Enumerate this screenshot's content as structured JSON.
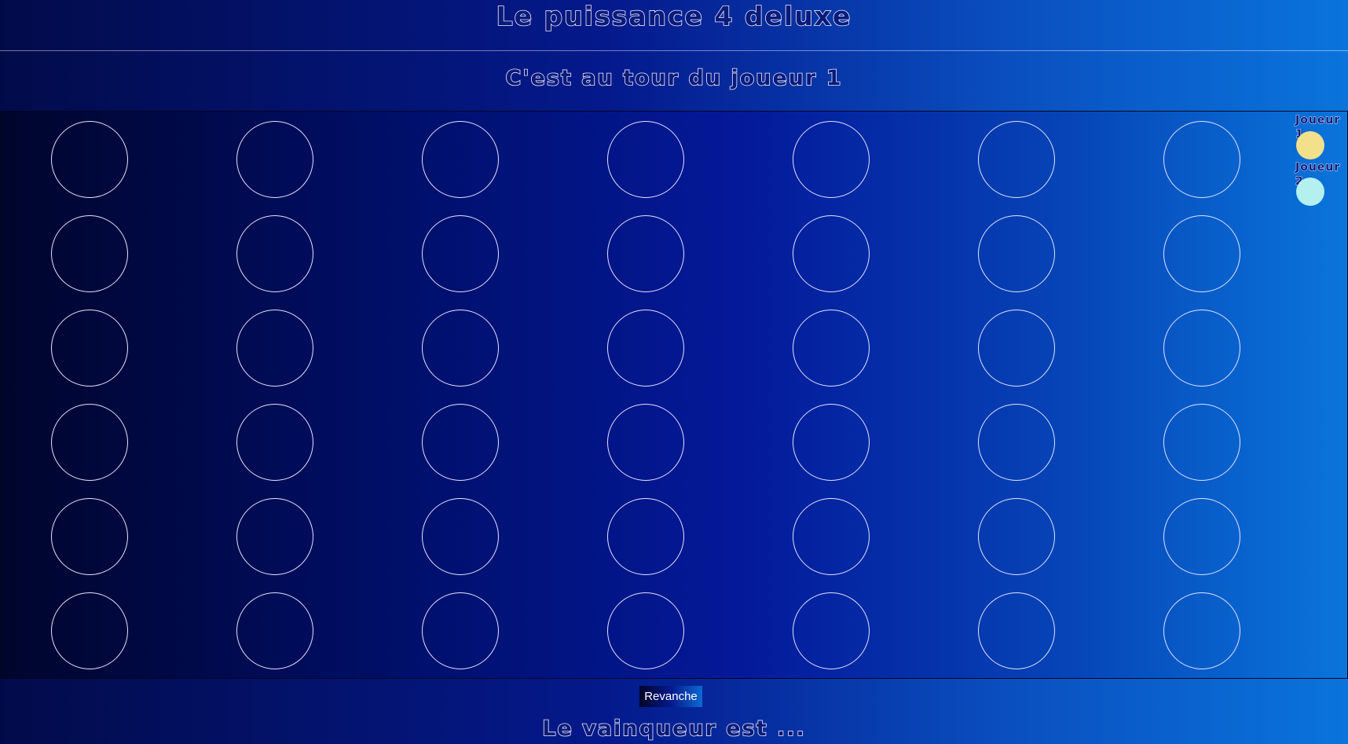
{
  "header": {
    "title": "Le puissance 4 deluxe"
  },
  "status": {
    "turn_text": "C'est au tour du joueur 1",
    "winner_text": "Le vainqueur est ..."
  },
  "board": {
    "columns": 7,
    "rows": 6,
    "cell_outline_color": "#dfe4ff",
    "cells": [
      [
        null,
        null,
        null,
        null,
        null,
        null,
        null
      ],
      [
        null,
        null,
        null,
        null,
        null,
        null,
        null
      ],
      [
        null,
        null,
        null,
        null,
        null,
        null,
        null
      ],
      [
        null,
        null,
        null,
        null,
        null,
        null,
        null
      ],
      [
        null,
        null,
        null,
        null,
        null,
        null,
        null
      ],
      [
        null,
        null,
        null,
        null,
        null,
        null,
        null
      ]
    ]
  },
  "legend": {
    "player1": {
      "label": "Joueur 1",
      "color": "#f2e08a"
    },
    "player2": {
      "label": "Joueur 2",
      "color": "#b4f0f0"
    }
  },
  "controls": {
    "rematch_label": "Revanche"
  },
  "colors": {
    "background_dark": "#020b4a",
    "background_light": "#0a74dc"
  }
}
